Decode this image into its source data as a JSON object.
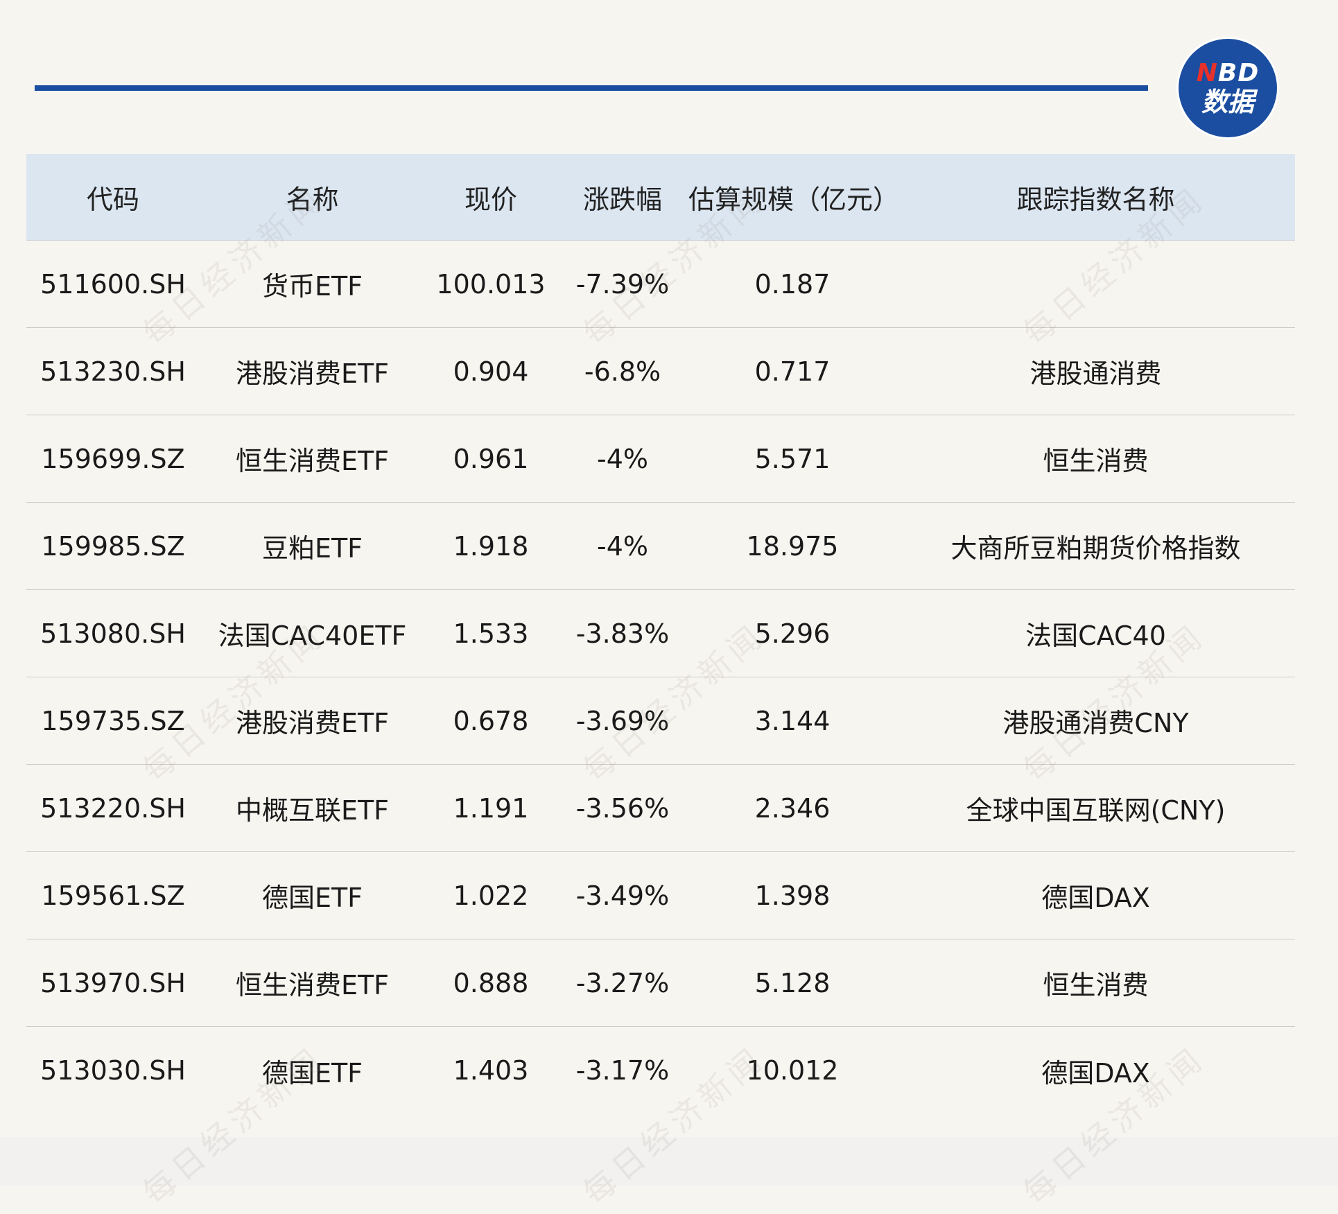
{
  "header": {
    "columns": [
      "代码",
      "名称",
      "现价",
      "涨跌幅",
      "估算规模（亿元）",
      "跟踪指数名称"
    ]
  },
  "rows": [
    [
      "511600.SH",
      "货币ETF",
      "100.013",
      "-7.39%",
      "0.187",
      ""
    ],
    [
      "513230.SH",
      "港股消费ETF",
      "0.904",
      "-6.8%",
      "0.717",
      "港股通消费"
    ],
    [
      "159699.SZ",
      "恒生消费ETF",
      "0.961",
      "-4%",
      "5.571",
      "恒生消费"
    ],
    [
      "159985.SZ",
      "豆粕ETF",
      "1.918",
      "-4%",
      "18.975",
      "大商所豆粕期货价格指数"
    ],
    [
      "513080.SH",
      "法国CAC40ETF",
      "1.533",
      "-3.83%",
      "5.296",
      "法国CAC40"
    ],
    [
      "159735.SZ",
      "港股消费ETF",
      "0.678",
      "-3.69%",
      "3.144",
      "港股通消费CNY"
    ],
    [
      "513220.SH",
      "中概互联ETF",
      "1.191",
      "-3.56%",
      "2.346",
      "全球中国互联网(CNY)"
    ],
    [
      "159561.SZ",
      "德国ETF",
      "1.022",
      "-3.49%",
      "1.398",
      "德国DAX"
    ],
    [
      "513970.SH",
      "恒生消费ETF",
      "0.888",
      "-3.27%",
      "5.128",
      "恒生消费"
    ],
    [
      "513030.SH",
      "德国ETF",
      "1.403",
      "-3.17%",
      "10.012",
      "德国DAX"
    ]
  ],
  "logo": {
    "line1_n": "N",
    "line1_rest": "BD",
    "line2": "数据"
  },
  "watermark": "每日经济新闻",
  "colors": {
    "accent": "#1b4ea0",
    "header_bg": "#dbe6f1",
    "logo_n": "#e8312a"
  }
}
